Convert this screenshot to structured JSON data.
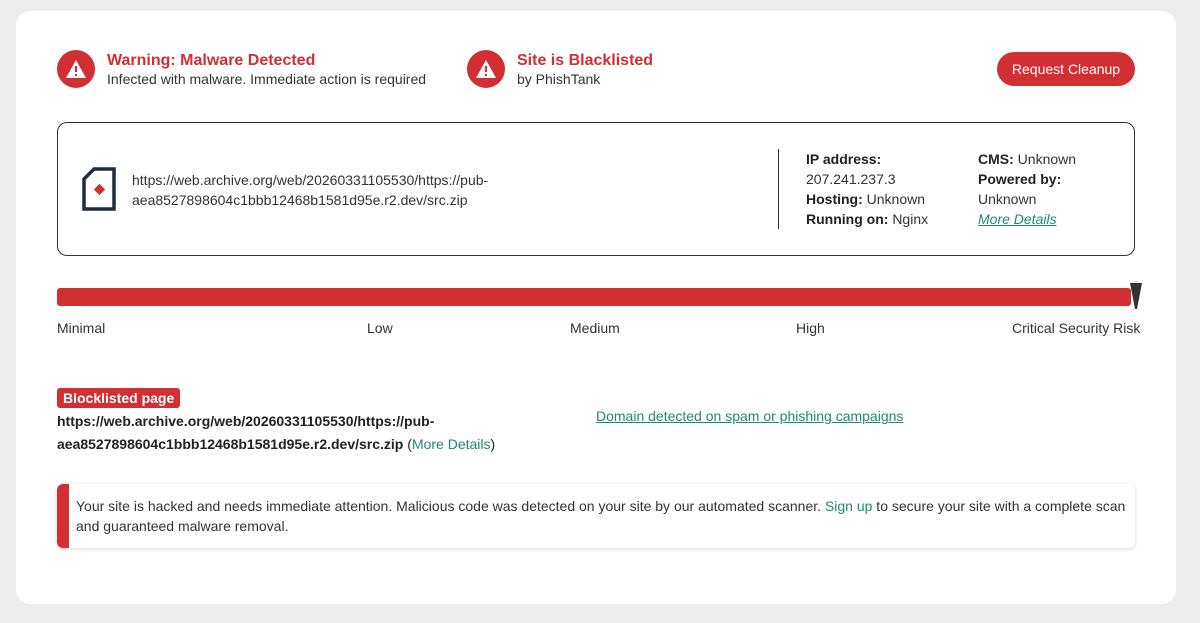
{
  "alerts": {
    "malware": {
      "title": "Warning: Malware Detected",
      "subtitle": "Infected with malware. Immediate action is required"
    },
    "blacklist": {
      "title": "Site is Blacklisted",
      "subtitle": "by PhishTank"
    }
  },
  "actions": {
    "request_cleanup": "Request Cleanup"
  },
  "site": {
    "url_line1": "https://web.archive.org/web/20260331105530/https://pub-",
    "url_line2": "aea8527898604c1bbb12468b1581d95e.r2.dev/src.zip",
    "ip_label": "IP address:",
    "ip_value": "207.241.237.3",
    "hosting_label": "Hosting:",
    "hosting_value": "Unknown",
    "running_label": "Running on:",
    "running_value": "Nginx",
    "cms_label": "CMS:",
    "cms_value": "Unknown",
    "powered_label": "Powered by:",
    "powered_value": "Unknown",
    "more_details": "More Details"
  },
  "risk": {
    "levels": [
      "Minimal",
      "Low",
      "Medium",
      "High",
      "Critical Security Risk"
    ],
    "current": "Critical Security Risk",
    "fill_fraction": 1.0
  },
  "blocklist": {
    "badge": "Blocklisted page",
    "url_line1": "https://web.archive.org/web/20260331105530/https://pub-",
    "url_line2": "aea8527898604c1bbb12468b1581d95e.r2.dev/src.zip",
    "more_open": " (",
    "more_details": "More Details",
    "more_close": ")",
    "spam_link": "Domain detected on spam or phishing campaigns"
  },
  "notice": {
    "text_before": "Your site is hacked and needs immediate attention. Malicious code was detected on your site by our automated scanner. ",
    "signup": "Sign up",
    "text_after": " to secure your site with a complete scan and guaranteed malware removal."
  },
  "colors": {
    "danger": "#d12f32",
    "link": "#1f8a70"
  },
  "icons": {
    "alert": "warning-triangle-icon",
    "file": "file-alert-icon",
    "marker": "risk-pointer-icon"
  }
}
